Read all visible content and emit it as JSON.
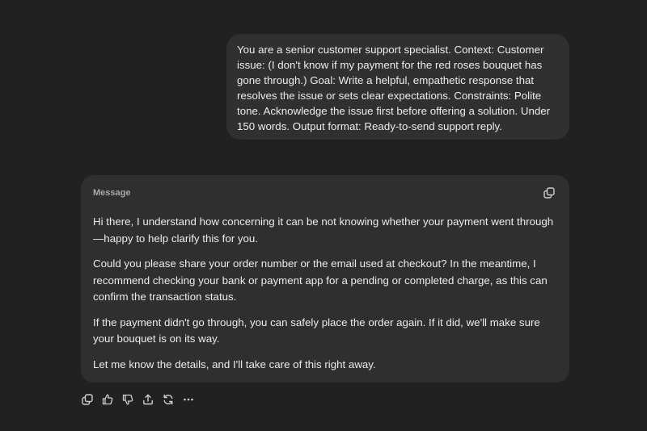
{
  "user_message": {
    "text": "You are a senior customer support specialist. Context: Customer issue: (I don't know if my payment for the red roses bouquet has gone through.) Goal: Write a helpful, empathetic response that resolves the issue or sets clear expectations. Constraints: Polite tone. Acknowledge the issue first before offering a solution. Under 150 words. Output format: Ready-to-send support reply."
  },
  "reply": {
    "label": "Message",
    "paragraphs": [
      "Hi there, I understand how concerning it can be not knowing whether your payment went through—happy to help clarify this for you.",
      "Could you please share your order number or the email used at checkout? In the meantime, I recommend checking your bank or payment app for a pending or completed charge, as this can confirm the transaction status.",
      "If the payment didn't go through, you can safely place the order again. If it did, we'll make sure your bouquet is on its way.",
      "Let me know the details, and I'll take care of this right away."
    ]
  },
  "actions": [
    {
      "icon": "copy-icon"
    },
    {
      "icon": "thumbs-up-icon"
    },
    {
      "icon": "thumbs-down-icon"
    },
    {
      "icon": "share-icon"
    },
    {
      "icon": "regenerate-icon"
    },
    {
      "icon": "more-icon"
    }
  ]
}
